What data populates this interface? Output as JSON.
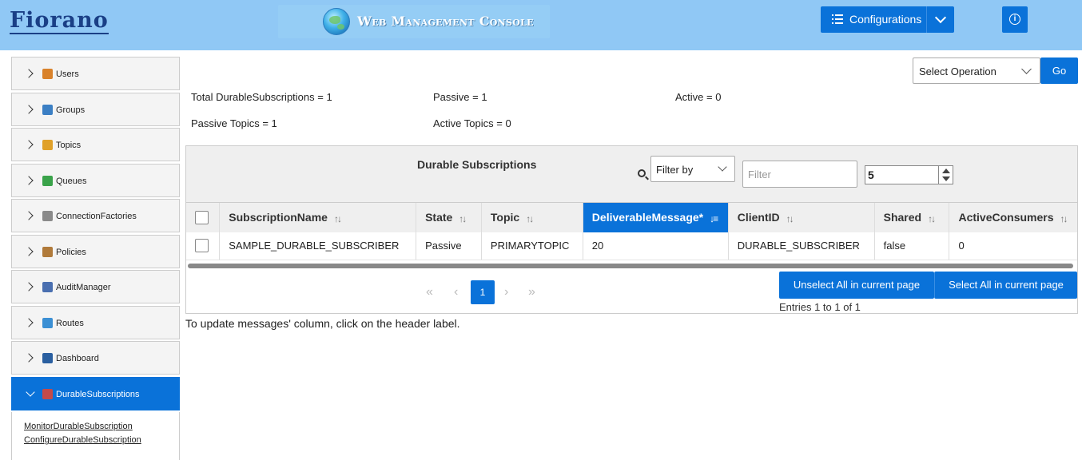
{
  "header": {
    "logo": "Fiorano",
    "console_title": "Web Management Console",
    "configurations_label": "Configurations",
    "info_glyph": "i"
  },
  "sidebar": {
    "items": [
      {
        "label": "Users",
        "icon": "user-icon",
        "color": "#d9822b"
      },
      {
        "label": "Groups",
        "icon": "group-icon",
        "color": "#3b7fc4"
      },
      {
        "label": "Topics",
        "icon": "topic-icon",
        "color": "#e0a12a"
      },
      {
        "label": "Queues",
        "icon": "queue-icon",
        "color": "#3aa34a"
      },
      {
        "label": "ConnectionFactories",
        "icon": "connection-factory-icon",
        "color": "#8a8a8a"
      },
      {
        "label": "Policies",
        "icon": "policy-icon",
        "color": "#b07a3a"
      },
      {
        "label": "AuditManager",
        "icon": "audit-icon",
        "color": "#4a6fb0"
      },
      {
        "label": "Routes",
        "icon": "route-icon",
        "color": "#3b8fd4"
      },
      {
        "label": "Dashboard",
        "icon": "dashboard-icon",
        "color": "#2a5fa0"
      },
      {
        "label": "DurableSubscriptions",
        "icon": "durable-subscription-icon",
        "color": "#c44a4a"
      }
    ],
    "sub_links": [
      "MonitorDurableSubscription",
      "ConfigureDurableSubscription"
    ]
  },
  "toolbar": {
    "select_operation": "Select Operation",
    "go_label": "Go"
  },
  "stats": {
    "total": "Total DurableSubscriptions = 1",
    "passive": "Passive = 1",
    "active": "Active = 0",
    "passive_topics": "Passive Topics = 1",
    "active_topics": "Active Topics = 0"
  },
  "panel": {
    "title": "Durable Subscriptions",
    "filter_by": "Filter by",
    "filter_placeholder": "Filter",
    "page_size": "5"
  },
  "table": {
    "columns": [
      "SubscriptionName",
      "State",
      "Topic",
      "DeliverableMessage*",
      "ClientID",
      "Shared",
      "ActiveConsumers"
    ],
    "sorted_column": "DeliverableMessage*",
    "rows": [
      [
        "SAMPLE_DURABLE_SUBSCRIBER",
        "Passive",
        "PRIMARYTOPIC",
        "20",
        "DURABLE_SUBSCRIBER",
        "false",
        "0"
      ]
    ]
  },
  "pagination": {
    "first": "«",
    "prev": "‹",
    "current": "1",
    "next": "›",
    "last": "»",
    "unselect_all": "Unselect All in current page",
    "select_all": "Select All in current page",
    "entries": "Entries 1 to 1 of 1"
  },
  "note": "To update messages' column, click on the header label."
}
